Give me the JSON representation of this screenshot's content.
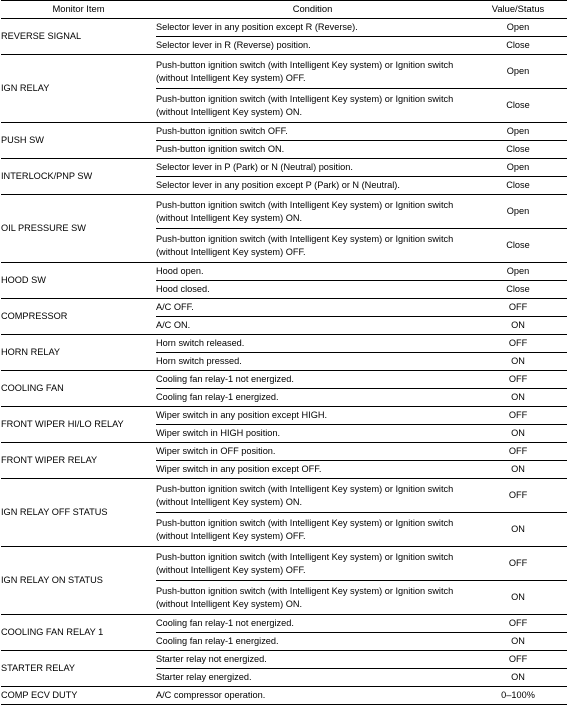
{
  "table": {
    "headers": {
      "monitor_item": "Monitor Item",
      "condition": "Condition",
      "value_status": "Value/Status"
    },
    "groups": [
      {
        "item": "REVERSE SIGNAL",
        "rows": [
          {
            "condition": "Selector lever in any position except R (Reverse).",
            "value": "Open",
            "lines": 1
          },
          {
            "condition": "Selector lever in R (Reverse) position.",
            "value": "Close",
            "lines": 1
          }
        ]
      },
      {
        "item": "IGN RELAY",
        "rows": [
          {
            "condition": "Push-button ignition switch (with Intelligent Key system) or Ignition switch (without Intelligent Key system) OFF.",
            "value": "Open",
            "lines": 2
          },
          {
            "condition": "Push-button ignition switch (with Intelligent Key system) or Ignition switch (without Intelligent Key system) ON.",
            "value": "Close",
            "lines": 2
          }
        ]
      },
      {
        "item": "PUSH SW",
        "rows": [
          {
            "condition": "Push-button ignition switch OFF.",
            "value": "Open",
            "lines": 1
          },
          {
            "condition": "Push-button ignition switch ON.",
            "value": "Close",
            "lines": 1
          }
        ]
      },
      {
        "item": "INTERLOCK/PNP SW",
        "rows": [
          {
            "condition": "Selector lever in P (Park) or N (Neutral) position.",
            "value": "Open",
            "lines": 1
          },
          {
            "condition": "Selector lever in any position except P (Park) or N (Neutral).",
            "value": "Close",
            "lines": 1
          }
        ]
      },
      {
        "item": "OIL PRESSURE SW",
        "rows": [
          {
            "condition": "Push-button ignition switch (with Intelligent Key system) or Ignition switch (without Intelligent Key system) ON.",
            "value": "Open",
            "lines": 2
          },
          {
            "condition": "Push-button ignition switch (with Intelligent Key system) or Ignition switch (without Intelligent Key system) OFF.",
            "value": "Close",
            "lines": 2
          }
        ]
      },
      {
        "item": "HOOD SW",
        "rows": [
          {
            "condition": "Hood open.",
            "value": "Open",
            "lines": 1
          },
          {
            "condition": "Hood closed.",
            "value": "Close",
            "lines": 1
          }
        ]
      },
      {
        "item": "COMPRESSOR",
        "rows": [
          {
            "condition": "A/C OFF.",
            "value": "OFF",
            "lines": 1
          },
          {
            "condition": "A/C ON.",
            "value": "ON",
            "lines": 1
          }
        ]
      },
      {
        "item": "HORN RELAY",
        "rows": [
          {
            "condition": "Horn switch released.",
            "value": "OFF",
            "lines": 1
          },
          {
            "condition": "Horn switch pressed.",
            "value": "ON",
            "lines": 1
          }
        ]
      },
      {
        "item": "COOLING FAN",
        "rows": [
          {
            "condition": "Cooling fan relay-1 not energized.",
            "value": "OFF",
            "lines": 1
          },
          {
            "condition": "Cooling fan relay-1 energized.",
            "value": "ON",
            "lines": 1
          }
        ]
      },
      {
        "item": "FRONT WIPER HI/LO RELAY",
        "rows": [
          {
            "condition": "Wiper switch in any position except HIGH.",
            "value": "OFF",
            "lines": 1
          },
          {
            "condition": "Wiper switch in HIGH position.",
            "value": "ON",
            "lines": 1
          }
        ]
      },
      {
        "item": "FRONT WIPER RELAY",
        "rows": [
          {
            "condition": "Wiper switch in OFF position.",
            "value": "OFF",
            "lines": 1
          },
          {
            "condition": "Wiper switch in any position except OFF.",
            "value": "ON",
            "lines": 1
          }
        ]
      },
      {
        "item": "IGN RELAY OFF STATUS",
        "rows": [
          {
            "condition": "Push-button ignition switch (with Intelligent Key system) or Ignition switch (without Intelligent Key system) ON.",
            "value": "OFF",
            "lines": 2
          },
          {
            "condition": "Push-button ignition switch (with Intelligent Key system) or Ignition switch (without Intelligent Key system) OFF.",
            "value": "ON",
            "lines": 2
          }
        ]
      },
      {
        "item": "IGN RELAY ON STATUS",
        "rows": [
          {
            "condition": "Push-button ignition switch (with Intelligent Key system) or Ignition switch (without Intelligent Key system) OFF.",
            "value": "OFF",
            "lines": 2
          },
          {
            "condition": "Push-button ignition switch (with Intelligent Key system) or Ignition switch (without Intelligent Key system) ON.",
            "value": "ON",
            "lines": 2
          }
        ]
      },
      {
        "item": "COOLING FAN RELAY 1",
        "rows": [
          {
            "condition": "Cooling fan relay-1 not energized.",
            "value": "OFF",
            "lines": 1
          },
          {
            "condition": "Cooling fan relay-1 energized.",
            "value": "ON",
            "lines": 1
          }
        ]
      },
      {
        "item": "STARTER RELAY",
        "rows": [
          {
            "condition": "Starter relay not energized.",
            "value": "OFF",
            "lines": 1
          },
          {
            "condition": "Starter relay energized.",
            "value": "ON",
            "lines": 1
          }
        ]
      },
      {
        "item": "COMP ECV DUTY",
        "rows": [
          {
            "condition": "A/C compressor operation.",
            "value": "0–100%",
            "lines": 1
          }
        ]
      }
    ]
  }
}
